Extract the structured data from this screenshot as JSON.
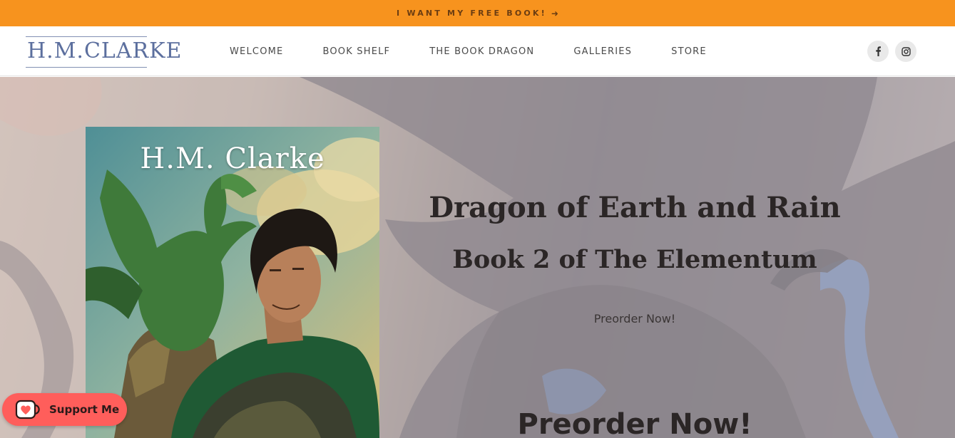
{
  "promo_bar": {
    "text": "I WANT MY FREE BOOK!",
    "arrow_icon": "arrow-right-icon",
    "background": "#f7931e"
  },
  "header": {
    "logo_text": "H.M.CLARKE",
    "nav": [
      {
        "label": "WELCOME"
      },
      {
        "label": "BOOK SHELF"
      },
      {
        "label": "THE BOOK DRAGON"
      },
      {
        "label": "GALLERIES"
      },
      {
        "label": "STORE"
      }
    ],
    "social": [
      {
        "icon": "facebook-icon"
      },
      {
        "icon": "instagram-icon"
      }
    ]
  },
  "hero": {
    "cover_author": "H.M. Clarke",
    "title": "Dragon of Earth and Rain",
    "subtitle": "Book 2 of The Elementum",
    "preorder_link": "Preorder Now!",
    "preorder_heading": "Preorder Now!"
  },
  "support": {
    "label": "Support Me",
    "icon": "coffee-cup-heart-icon",
    "color": "#ff5e5b"
  }
}
